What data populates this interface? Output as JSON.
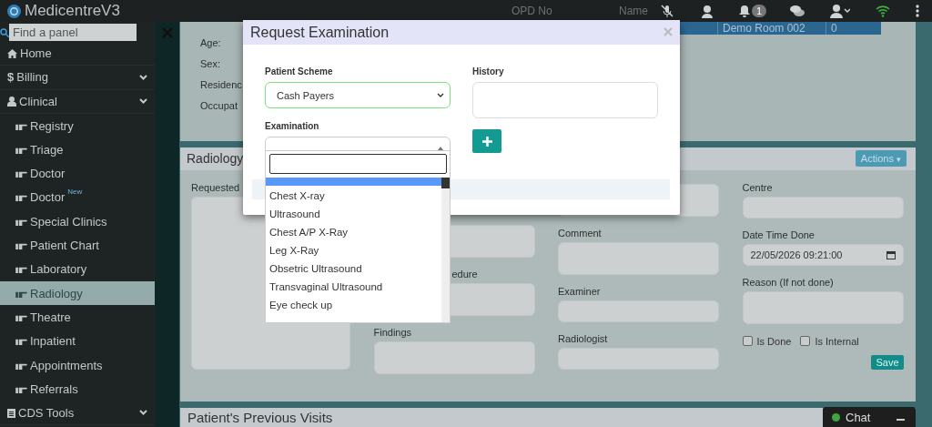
{
  "app": {
    "title": "MedicentreV3"
  },
  "topbar": {
    "columns": [
      "OPD No",
      "Name"
    ],
    "notification_count": "1"
  },
  "sidebar": {
    "search_placeholder": "Find a panel",
    "items": [
      {
        "label": "Home",
        "kind": "home",
        "selected": false
      },
      {
        "label": "Billing",
        "kind": "money",
        "glyph": "$",
        "selected": false,
        "expandable": true
      },
      {
        "label": "Clinical",
        "kind": "clinical",
        "selected": false,
        "expandable": true,
        "children": [
          {
            "label": "Registry",
            "selected": false
          },
          {
            "label": "Triage",
            "selected": false
          },
          {
            "label": "Doctor",
            "selected": false
          },
          {
            "label": "Doctor",
            "badge": "New",
            "selected": false
          },
          {
            "label": "Special Clinics",
            "selected": false
          },
          {
            "label": "Patient Chart",
            "selected": false
          },
          {
            "label": "Laboratory",
            "selected": false
          },
          {
            "label": "Radiology",
            "selected": true
          },
          {
            "label": "Theatre",
            "selected": false
          },
          {
            "label": "Inpatient",
            "selected": false
          },
          {
            "label": "Appointments",
            "selected": false
          },
          {
            "label": "Referrals",
            "selected": false
          }
        ]
      },
      {
        "label": "CDS Tools",
        "kind": "tools",
        "selected": false,
        "expandable": true
      }
    ]
  },
  "patient": {
    "labels": [
      "Age:",
      "Sex:",
      "Residenc",
      "Occupat"
    ],
    "visit_row": [
      "Demo Room 002",
      "0"
    ]
  },
  "radiology": {
    "title": "Radiology",
    "actions": "Actions",
    "actions_caret": "▾",
    "requested_label": "Requested",
    "columns": [
      [
        {
          "kind": "textarea"
        },
        {
          "label": "edure",
          "kind": "textarea"
        },
        {
          "label": "Findings",
          "kind": "textarea"
        }
      ],
      [
        {
          "kind": "textarea"
        },
        {
          "label": "Comment",
          "kind": "textarea"
        },
        {
          "label": "Examiner",
          "kind": "input"
        },
        {
          "label": "Radiologist",
          "kind": "input"
        }
      ],
      [
        {
          "label": "Centre",
          "kind": "input"
        },
        {
          "label": "Date Time Done",
          "kind": "date",
          "value": "22/05/2026 09:21:00"
        },
        {
          "label": "Reason (If not done)",
          "kind": "textarea"
        }
      ]
    ],
    "checkboxes": [
      {
        "label": "Is Done",
        "checked": false
      },
      {
        "label": "Is Internal",
        "checked": false
      }
    ],
    "save": "Save"
  },
  "previous_visits": {
    "title": "Patient's Previous Visits"
  },
  "chat": {
    "label": "Chat"
  },
  "modal": {
    "title": "Request Examination",
    "scheme": {
      "label": "Patient Scheme",
      "value": "Cash Payers"
    },
    "history": {
      "label": "History"
    },
    "examination": {
      "label": "Examination",
      "options": [
        {
          "label": "Chest X-ray",
          "selected": false
        },
        {
          "label": "Ultrasound",
          "selected": false
        },
        {
          "label": "Chest A/P X-Ray",
          "selected": false
        },
        {
          "label": "Leg X-Ray",
          "selected": false
        },
        {
          "label": "Obsetric Ultrasound",
          "selected": false
        },
        {
          "label": "Transvaginal Ultrasound",
          "selected": false
        },
        {
          "label": "Eye check up",
          "selected": false
        }
      ]
    }
  }
}
